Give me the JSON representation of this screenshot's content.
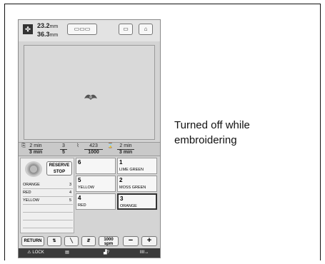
{
  "screen": {
    "dimensions": {
      "width": "23.2",
      "height": "36.3",
      "unit": "mm"
    },
    "top_buttons": {
      "layout_label": "▭▭▭",
      "frame_label": "▭",
      "home_label": "⌂"
    },
    "status": {
      "color_change_time": {
        "value": "2",
        "unit": "min"
      },
      "color_change_total": {
        "value": "3",
        "unit": "min"
      },
      "color_current": "3",
      "color_total": "5",
      "stitch_current": "423",
      "stitch_total": "1000",
      "time_remaining": {
        "value": "2",
        "unit": "min"
      },
      "time_total": {
        "value": "3",
        "unit": "min"
      }
    },
    "reserve_stop_label": "RESERVE STOP",
    "sequence": [
      {
        "name": "ORANGE",
        "needle": "3"
      },
      {
        "name": "RED",
        "needle": "4"
      },
      {
        "name": "YELLOW",
        "needle": "5"
      }
    ],
    "needles": [
      {
        "num": "6",
        "color": ""
      },
      {
        "num": "1",
        "color": "LIME GREEN"
      },
      {
        "num": "5",
        "color": "YELLOW"
      },
      {
        "num": "2",
        "color": "MOSS GREEN"
      },
      {
        "num": "4",
        "color": "RED"
      },
      {
        "num": "3",
        "color": "ORANGE"
      }
    ],
    "bottom": {
      "return_label": "RETURN",
      "speed_value": "1000",
      "speed_unit": "spm",
      "minus_label": "−",
      "plus_label": "+"
    },
    "nav": {
      "lock_label": "LOCK"
    }
  },
  "caption": "Turned off while embroidering"
}
